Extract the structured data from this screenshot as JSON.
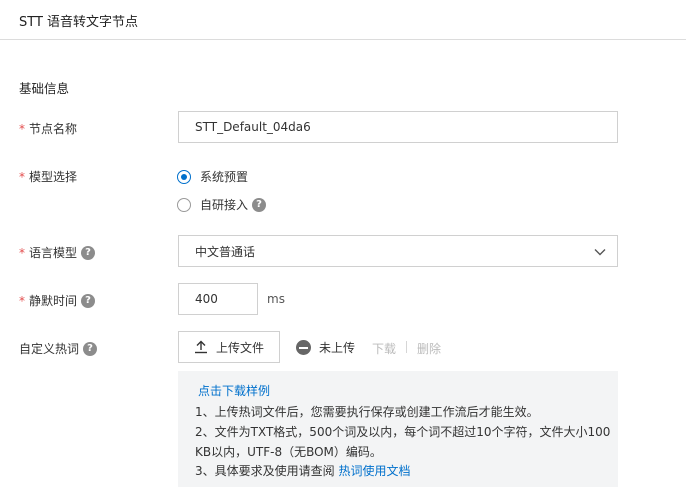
{
  "header": {
    "title": "STT 语音转文字节点"
  },
  "section": {
    "title": "基础信息"
  },
  "form": {
    "node_name": {
      "required_mark": "*",
      "label": "节点名称",
      "value": "STT_Default_04da6"
    },
    "model_select": {
      "required_mark": "*",
      "label": "模型选择",
      "options": [
        {
          "label": "系统预置",
          "checked": true
        },
        {
          "label": "自研接入",
          "checked": false
        }
      ]
    },
    "language_model": {
      "required_mark": "*",
      "label": "语言模型",
      "selected": "中文普通话"
    },
    "silence_time": {
      "required_mark": "*",
      "label": "静默时间",
      "value": "400",
      "unit": "ms"
    },
    "hotwords": {
      "label": "自定义热词",
      "upload_label": "上传文件",
      "status": "未上传",
      "download": "下载",
      "delete": "删除",
      "sample_link": "点击下载样例",
      "notes": [
        "1、上传热词文件后，您需要执行保存或创建工作流后才能生效。",
        "2、文件为TXT格式，500个词及以内，每个词不超过10个字符，文件大小100",
        "KB以内，UTF-8（无BOM）编码。"
      ],
      "note3_prefix": "3、具体要求及使用请查阅",
      "doc_link": "热词使用文档"
    }
  },
  "colors": {
    "accent": "#0070cc",
    "required": "#e34d4d",
    "info_bg": "#f3f4f5"
  },
  "icons": {
    "help": "help-icon",
    "upload": "upload-icon",
    "chevron": "chevron-down-icon",
    "status": "minus-circle-icon"
  }
}
